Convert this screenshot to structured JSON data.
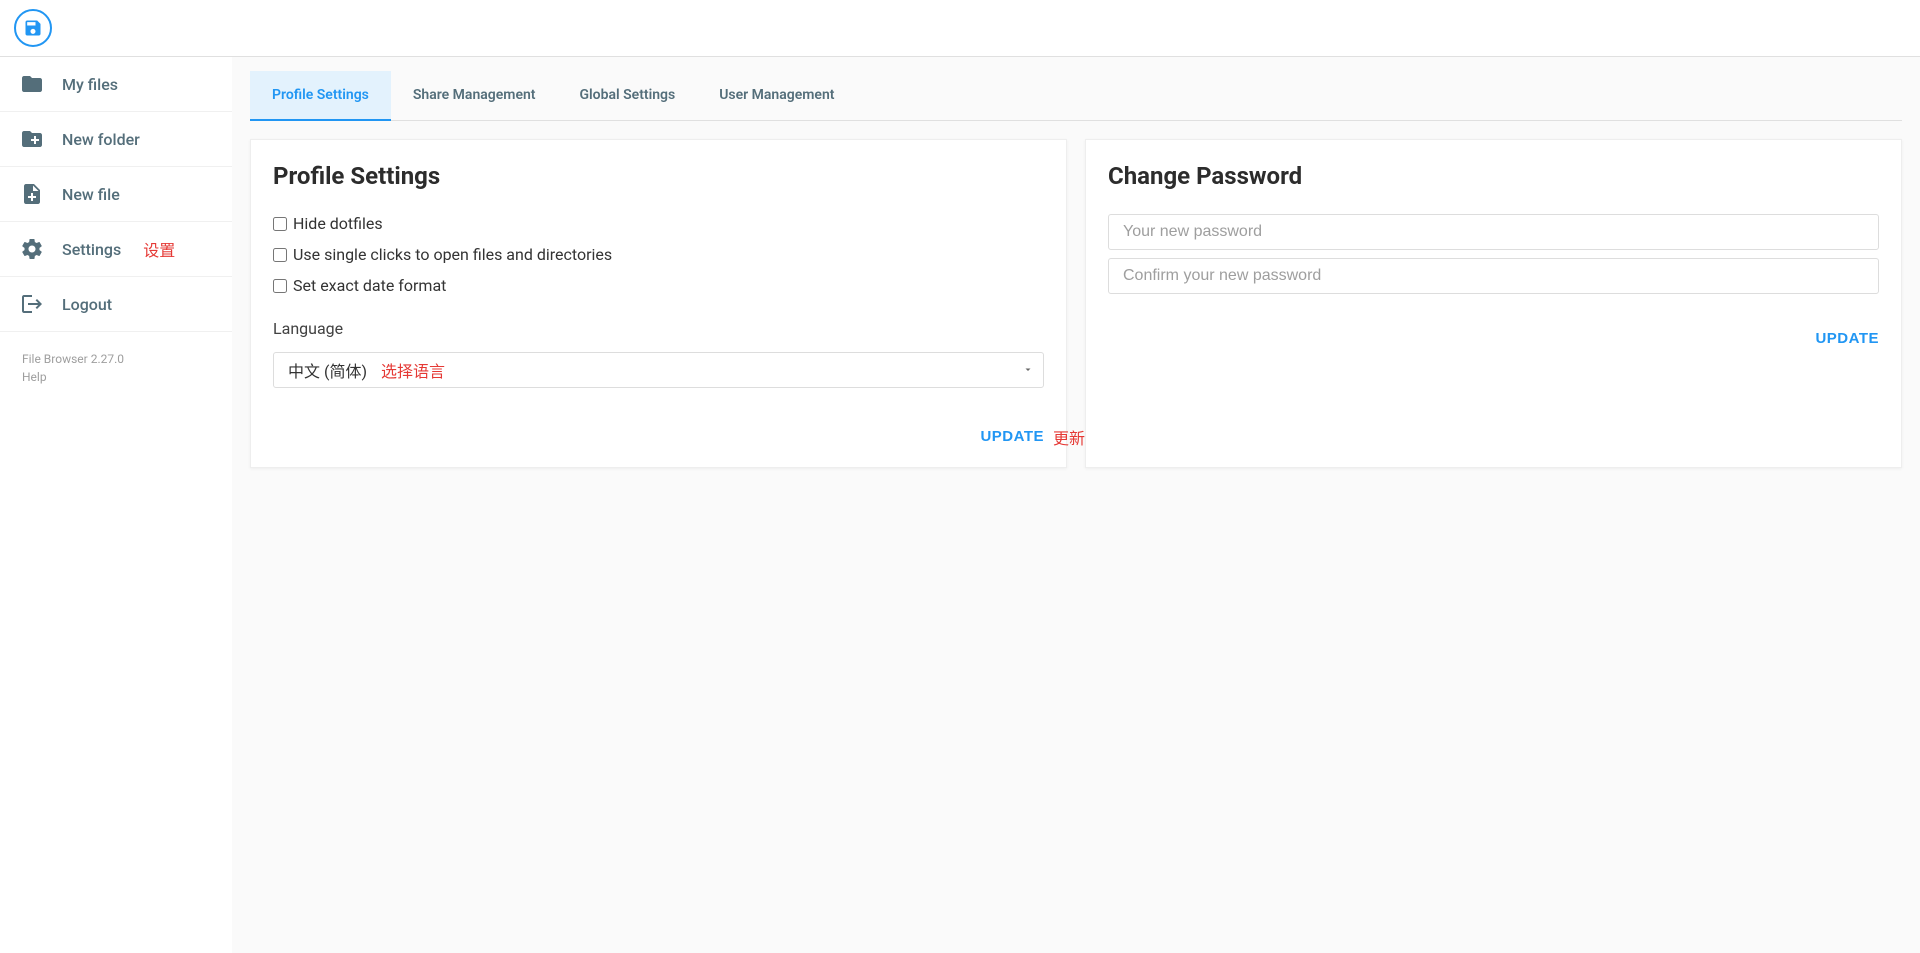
{
  "sidebar": {
    "items": [
      {
        "label": "My files",
        "icon": "folder"
      },
      {
        "label": "New folder",
        "icon": "create-folder"
      },
      {
        "label": "New file",
        "icon": "note-add"
      },
      {
        "label": "Settings",
        "icon": "settings",
        "annotation": "设置"
      },
      {
        "label": "Logout",
        "icon": "logout"
      }
    ],
    "footer": {
      "version": "File Browser 2.27.0",
      "help": "Help"
    }
  },
  "tabs": [
    {
      "label": "Profile Settings",
      "active": true
    },
    {
      "label": "Share Management",
      "active": false
    },
    {
      "label": "Global Settings",
      "active": false
    },
    {
      "label": "User Management",
      "active": false
    }
  ],
  "profileCard": {
    "title": "Profile Settings",
    "checkboxes": [
      {
        "label": "Hide dotfiles",
        "checked": false
      },
      {
        "label": "Use single clicks to open files and directories",
        "checked": false
      },
      {
        "label": "Set exact date format",
        "checked": false
      }
    ],
    "languageLabel": "Language",
    "languageValue": "中文 (简体)",
    "languageAnnotation": "选择语言",
    "updateLabel": "UPDATE",
    "updateAnnotation": "更新"
  },
  "passwordCard": {
    "title": "Change Password",
    "placeholder1": "Your new password",
    "placeholder2": "Confirm your new password",
    "updateLabel": "UPDATE"
  }
}
